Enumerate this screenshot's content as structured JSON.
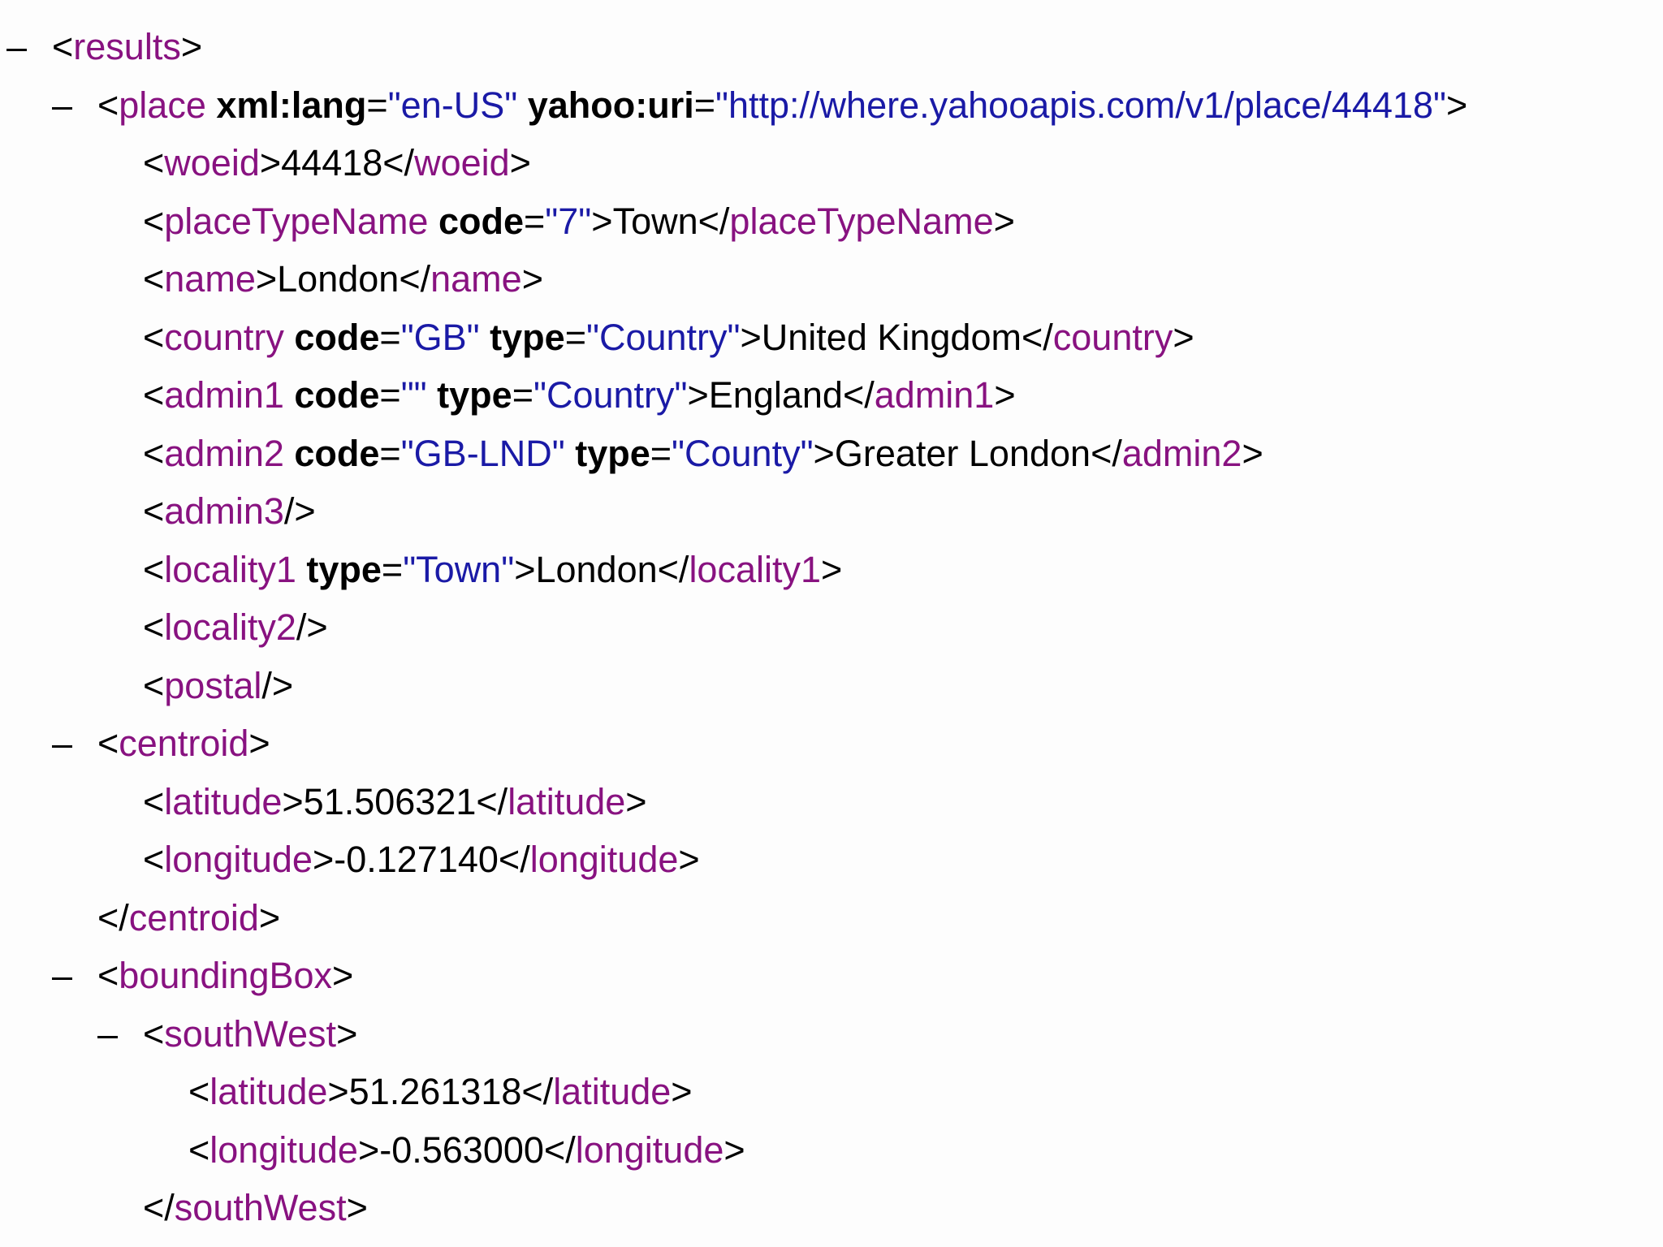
{
  "collapse_glyph": "–",
  "xml_tree": [
    {
      "toggle": true,
      "parts": [
        [
          "p",
          "<"
        ],
        [
          "t",
          "results"
        ],
        [
          "p",
          ">"
        ]
      ]
    },
    {
      "toggle": true,
      "parts": [
        [
          "p",
          "<"
        ],
        [
          "t",
          "place"
        ],
        [
          "p",
          " "
        ],
        [
          "a",
          "xml:lang"
        ],
        [
          "p",
          "="
        ],
        [
          "v",
          "\"en-US\""
        ],
        [
          "p",
          " "
        ],
        [
          "a",
          "yahoo:uri"
        ],
        [
          "p",
          "="
        ],
        [
          "v",
          "\"http://where.yahooapis.com/v1/place/44418\""
        ],
        [
          "p",
          ">"
        ]
      ]
    },
    {
      "toggle": false,
      "parts": [
        [
          "p",
          "<"
        ],
        [
          "t",
          "woeid"
        ],
        [
          "p",
          ">"
        ],
        [
          "x",
          "44418"
        ],
        [
          "p",
          "</"
        ],
        [
          "t",
          "woeid"
        ],
        [
          "p",
          ">"
        ]
      ]
    },
    {
      "toggle": false,
      "parts": [
        [
          "p",
          "<"
        ],
        [
          "t",
          "placeTypeName"
        ],
        [
          "p",
          " "
        ],
        [
          "a",
          "code"
        ],
        [
          "p",
          "="
        ],
        [
          "v",
          "\"7\""
        ],
        [
          "p",
          ">"
        ],
        [
          "x",
          "Town"
        ],
        [
          "p",
          "</"
        ],
        [
          "t",
          "placeTypeName"
        ],
        [
          "p",
          ">"
        ]
      ]
    },
    {
      "toggle": false,
      "parts": [
        [
          "p",
          "<"
        ],
        [
          "t",
          "name"
        ],
        [
          "p",
          ">"
        ],
        [
          "x",
          "London"
        ],
        [
          "p",
          "</"
        ],
        [
          "t",
          "name"
        ],
        [
          "p",
          ">"
        ]
      ]
    },
    {
      "toggle": false,
      "parts": [
        [
          "p",
          "<"
        ],
        [
          "t",
          "country"
        ],
        [
          "p",
          " "
        ],
        [
          "a",
          "code"
        ],
        [
          "p",
          "="
        ],
        [
          "v",
          "\"GB\""
        ],
        [
          "p",
          " "
        ],
        [
          "a",
          "type"
        ],
        [
          "p",
          "="
        ],
        [
          "v",
          "\"Country\""
        ],
        [
          "p",
          ">"
        ],
        [
          "x",
          "United Kingdom"
        ],
        [
          "p",
          "</"
        ],
        [
          "t",
          "country"
        ],
        [
          "p",
          ">"
        ]
      ]
    },
    {
      "toggle": false,
      "parts": [
        [
          "p",
          "<"
        ],
        [
          "t",
          "admin1"
        ],
        [
          "p",
          " "
        ],
        [
          "a",
          "code"
        ],
        [
          "p",
          "="
        ],
        [
          "v",
          "\"\""
        ],
        [
          "p",
          " "
        ],
        [
          "a",
          "type"
        ],
        [
          "p",
          "="
        ],
        [
          "v",
          "\"Country\""
        ],
        [
          "p",
          ">"
        ],
        [
          "x",
          "England"
        ],
        [
          "p",
          "</"
        ],
        [
          "t",
          "admin1"
        ],
        [
          "p",
          ">"
        ]
      ]
    },
    {
      "toggle": false,
      "parts": [
        [
          "p",
          "<"
        ],
        [
          "t",
          "admin2"
        ],
        [
          "p",
          " "
        ],
        [
          "a",
          "code"
        ],
        [
          "p",
          "="
        ],
        [
          "v",
          "\"GB-LND\""
        ],
        [
          "p",
          " "
        ],
        [
          "a",
          "type"
        ],
        [
          "p",
          "="
        ],
        [
          "v",
          "\"County\""
        ],
        [
          "p",
          ">"
        ],
        [
          "x",
          "Greater London"
        ],
        [
          "p",
          "</"
        ],
        [
          "t",
          "admin2"
        ],
        [
          "p",
          ">"
        ]
      ]
    },
    {
      "toggle": false,
      "parts": [
        [
          "p",
          "<"
        ],
        [
          "t",
          "admin3"
        ],
        [
          "p",
          "/>"
        ]
      ]
    },
    {
      "toggle": false,
      "parts": [
        [
          "p",
          "<"
        ],
        [
          "t",
          "locality1"
        ],
        [
          "p",
          " "
        ],
        [
          "a",
          "type"
        ],
        [
          "p",
          "="
        ],
        [
          "v",
          "\"Town\""
        ],
        [
          "p",
          ">"
        ],
        [
          "x",
          "London"
        ],
        [
          "p",
          "</"
        ],
        [
          "t",
          "locality1"
        ],
        [
          "p",
          ">"
        ]
      ]
    },
    {
      "toggle": false,
      "parts": [
        [
          "p",
          "<"
        ],
        [
          "t",
          "locality2"
        ],
        [
          "p",
          "/>"
        ]
      ]
    },
    {
      "toggle": false,
      "parts": [
        [
          "p",
          "<"
        ],
        [
          "t",
          "postal"
        ],
        [
          "p",
          "/>"
        ]
      ]
    },
    {
      "toggle": true,
      "parts": [
        [
          "p",
          "<"
        ],
        [
          "t",
          "centroid"
        ],
        [
          "p",
          ">"
        ]
      ]
    },
    {
      "toggle": false,
      "parts": [
        [
          "p",
          "<"
        ],
        [
          "t",
          "latitude"
        ],
        [
          "p",
          ">"
        ],
        [
          "x",
          "51.506321"
        ],
        [
          "p",
          "</"
        ],
        [
          "t",
          "latitude"
        ],
        [
          "p",
          ">"
        ]
      ]
    },
    {
      "toggle": false,
      "parts": [
        [
          "p",
          "<"
        ],
        [
          "t",
          "longitude"
        ],
        [
          "p",
          ">"
        ],
        [
          "x",
          "-0.127140"
        ],
        [
          "p",
          "</"
        ],
        [
          "t",
          "longitude"
        ],
        [
          "p",
          ">"
        ]
      ]
    },
    {
      "toggle": false,
      "parts": [
        [
          "p",
          "</"
        ],
        [
          "t",
          "centroid"
        ],
        [
          "p",
          ">"
        ]
      ]
    },
    {
      "toggle": true,
      "parts": [
        [
          "p",
          "<"
        ],
        [
          "t",
          "boundingBox"
        ],
        [
          "p",
          ">"
        ]
      ]
    },
    {
      "toggle": true,
      "parts": [
        [
          "p",
          "<"
        ],
        [
          "t",
          "southWest"
        ],
        [
          "p",
          ">"
        ]
      ]
    },
    {
      "toggle": false,
      "parts": [
        [
          "p",
          "<"
        ],
        [
          "t",
          "latitude"
        ],
        [
          "p",
          ">"
        ],
        [
          "x",
          "51.261318"
        ],
        [
          "p",
          "</"
        ],
        [
          "t",
          "latitude"
        ],
        [
          "p",
          ">"
        ]
      ]
    },
    {
      "toggle": false,
      "parts": [
        [
          "p",
          "<"
        ],
        [
          "t",
          "longitude"
        ],
        [
          "p",
          ">"
        ],
        [
          "x",
          "-0.563000"
        ],
        [
          "p",
          "</"
        ],
        [
          "t",
          "longitude"
        ],
        [
          "p",
          ">"
        ]
      ]
    },
    {
      "toggle": false,
      "parts": [
        [
          "p",
          "</"
        ],
        [
          "t",
          "southWest"
        ],
        [
          "p",
          ">"
        ]
      ]
    }
  ]
}
